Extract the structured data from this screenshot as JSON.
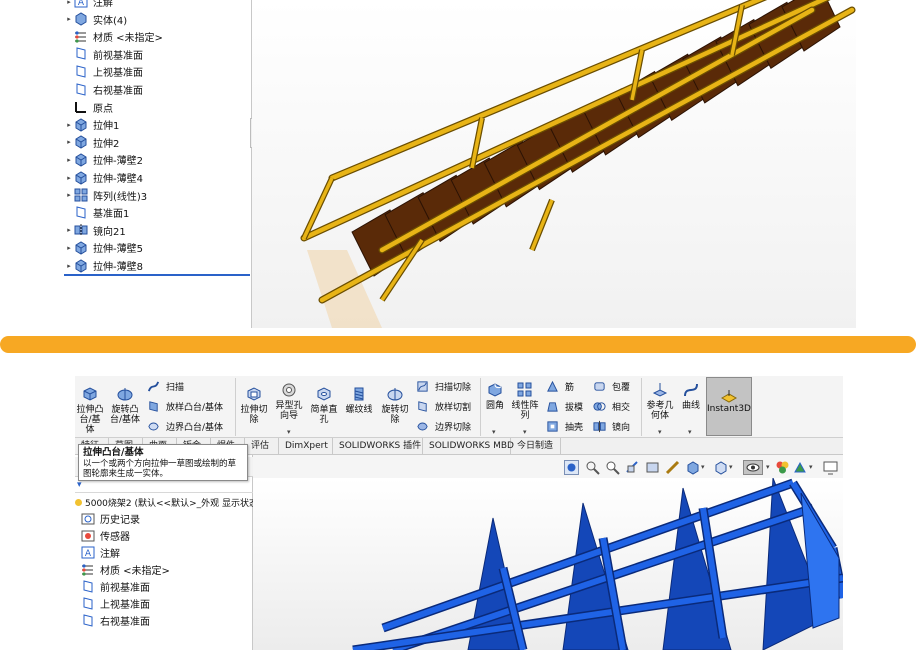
{
  "top_tree": {
    "items": [
      {
        "label": "注解",
        "icon": "annotation-icon",
        "expand": true
      },
      {
        "label": "实体(4)",
        "icon": "solid-bodies-icon",
        "expand": true
      },
      {
        "label": "材质 <未指定>",
        "icon": "material-icon",
        "expand": false
      },
      {
        "label": "前视基准面",
        "icon": "plane-icon",
        "expand": false
      },
      {
        "label": "上视基准面",
        "icon": "plane-icon",
        "expand": false
      },
      {
        "label": "右视基准面",
        "icon": "plane-icon",
        "expand": false
      },
      {
        "label": "原点",
        "icon": "origin-icon",
        "expand": false
      },
      {
        "label": "拉伸1",
        "icon": "extrude-icon",
        "expand": true
      },
      {
        "label": "拉伸2",
        "icon": "extrude-icon",
        "expand": true
      },
      {
        "label": "拉伸-薄壁2",
        "icon": "extrude-icon",
        "expand": true
      },
      {
        "label": "拉伸-薄壁4",
        "icon": "extrude-icon",
        "expand": true
      },
      {
        "label": "阵列(线性)3",
        "icon": "linear-pattern-icon",
        "expand": true
      },
      {
        "label": "基准面1",
        "icon": "plane-icon",
        "expand": false
      },
      {
        "label": "镜向21",
        "icon": "mirror-icon",
        "expand": true
      },
      {
        "label": "拉伸-薄壁5",
        "icon": "extrude-icon",
        "expand": true
      },
      {
        "label": "拉伸-薄壁8",
        "icon": "extrude-icon",
        "expand": true
      }
    ]
  },
  "divider_color": "#f7a823",
  "ribbon": {
    "extrude_boss": "拉伸凸\n台/基体",
    "revolve_boss": "旋转凸\n台/基体",
    "sweep": "扫描",
    "loft_boss": "放样凸台/基体",
    "boundary_boss": "边界凸台/基体",
    "extrude_cut": "拉伸切\n除",
    "hole_wizard": "异型孔\n向导",
    "simple_hole": "简单直\n孔",
    "thread": "螺纹线",
    "revolve_cut": "旋转切\n除",
    "swept_cut": "扫描切除",
    "lofted_cut": "放样切割",
    "boundary_cut": "边界切除",
    "fillet": "圆角",
    "linear_pattern": "线性阵\n列",
    "rib": "筋",
    "draft": "拔模",
    "shell": "抽壳",
    "wrap": "包覆",
    "intersect": "相交",
    "mirror": "镜向",
    "ref_geometry": "参考几\n何体",
    "curves": "曲线",
    "instant3d": "Instant3D"
  },
  "tabs": [
    "特征",
    "草图",
    "曲面",
    "钣金",
    "焊件",
    "评估",
    "DimXpert",
    "SOLIDWORKS 插件",
    "SOLIDWORKS MBD",
    "今日制造"
  ],
  "tooltip": {
    "title": "拉伸凸台/基体",
    "body": "以一个或两个方向拉伸一草图或绘制的草图轮廓来生成一实体。"
  },
  "bottom_tree": {
    "part_name": "5000烧架2 (默认<<默认>_外观 显示状态",
    "items": [
      {
        "label": "历史记录",
        "icon": "history-icon"
      },
      {
        "label": "传感器",
        "icon": "sensor-icon"
      },
      {
        "label": "注解",
        "icon": "annotation-icon"
      },
      {
        "label": "材质 <未指定>",
        "icon": "material-icon"
      },
      {
        "label": "前视基准面",
        "icon": "plane-icon"
      },
      {
        "label": "上视基准面",
        "icon": "plane-icon"
      },
      {
        "label": "右视基准面",
        "icon": "plane-icon"
      }
    ]
  },
  "colors": {
    "stair_frame": "#e8b416",
    "stair_tread": "#5a2a08",
    "rack_blue": "#1f63e6",
    "selection_blue": "#2a62c9"
  }
}
